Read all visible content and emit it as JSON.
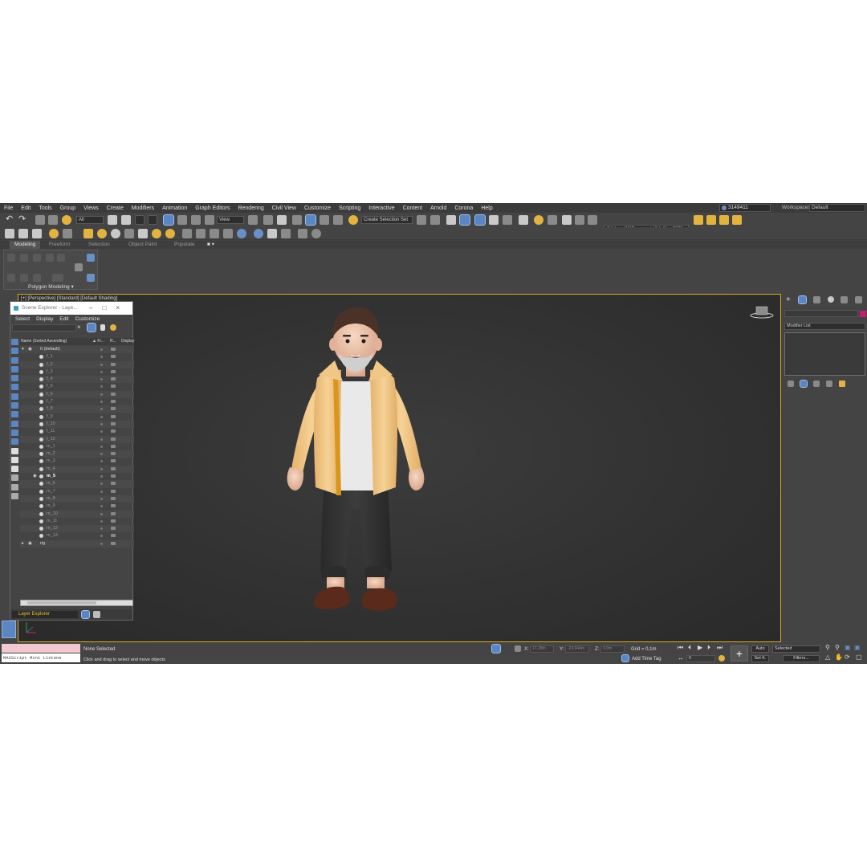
{
  "menubar": {
    "items": [
      "File",
      "Edit",
      "Tools",
      "Group",
      "Views",
      "Create",
      "Modifiers",
      "Animation",
      "Graph Editors",
      "Rendering",
      "Civil View",
      "Customize",
      "Scripting",
      "Interactive",
      "Content",
      "Arnold",
      "Corona",
      "Help"
    ],
    "user": "3149411",
    "workspaces_label": "Workspaces:",
    "workspace_value": "Default"
  },
  "toolbar": {
    "selection_filter": "All",
    "reference_coord": "View",
    "selection_set": "Create Selection Set",
    "project_path": "C:\\Users\\10\\Documents\\3ds Max 2020"
  },
  "ribbon": {
    "tabs": [
      "Modeling",
      "Freeform",
      "Selection",
      "Object Paint",
      "Populate"
    ],
    "panel_label": "Polygon Modeling ▾"
  },
  "viewport": {
    "label": "[+] [Perspective] [Standard] [Default Shading]"
  },
  "scene_explorer": {
    "title": "Scene Explorer - Laye...",
    "menu": [
      "Select",
      "Display",
      "Edit",
      "Customize"
    ],
    "header_name": "Name (Sorted Ascending)",
    "header_fr": "▲ Fr...",
    "header_r": "R...",
    "header_display": "Display",
    "default_layer": "0 (default)",
    "objects": [
      "f_1",
      "f_2",
      "f_3",
      "f_4",
      "f_5",
      "f_6",
      "f_7",
      "f_8",
      "f_9",
      "f_10",
      "f_11",
      "f_12",
      "m_1",
      "m_2",
      "m_3",
      "m_4",
      "m_5",
      "m_6",
      "m_7",
      "m_8",
      "m_9",
      "m_10",
      "m_11",
      "m_12",
      "m_13"
    ],
    "highlighted_object": "m_5",
    "rig_layer": "rig",
    "footer_label": "Layer Explorer"
  },
  "command_panel": {
    "modifier_list": "Modifier List",
    "accent_color": "#c21b7a"
  },
  "statusbar": {
    "maxscript": "MAXScript Mini Listene",
    "selection_status": "None Selected",
    "prompt": "Click and drag to select and move objects",
    "x_label": "X:",
    "x_value": "17,28m",
    "y_label": "Y:",
    "y_value": "-24,944m",
    "z_label": "Z:",
    "z_value": "0,0m",
    "grid": "Grid = 0,1m",
    "add_time_tag": "Add Time Tag",
    "auto": "Auto",
    "set_key": "Set K.",
    "key_filter": "Selected",
    "filters": "Filters...",
    "frame": "0"
  },
  "colors": {
    "selection_accent": "#5b86c2",
    "viewport_border": "#d6a928",
    "layer_explorer_text": "#e3c02a"
  }
}
